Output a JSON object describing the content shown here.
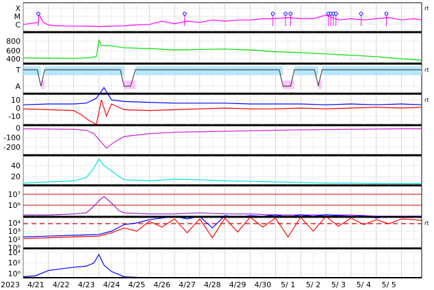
{
  "chart_data": [
    {
      "type": "line",
      "panel": "xray-flares",
      "ylabels": [
        "X",
        "M",
        "C"
      ],
      "right_label": "rt",
      "colors": {
        "line": "#ff00ff",
        "marker": "#0000ff"
      },
      "series": [
        {
          "x": [
            0,
            0.6,
            0.6,
            0.8,
            1,
            1.2,
            1.5,
            2,
            2.5,
            3,
            3.5,
            4,
            4.5,
            5,
            5.5,
            6,
            6.5,
            7,
            7.5,
            8,
            8.5,
            9,
            9.5,
            10,
            10.5,
            11,
            11.5,
            12,
            12.5,
            13,
            13.5,
            14,
            14.5,
            15,
            15.5,
            15.8
          ],
          "values": [
            0.12,
            0.2,
            0.55,
            0.2,
            0.1,
            0.07,
            0.06,
            0.05,
            0.05,
            0.04,
            0.05,
            0.06,
            0.1,
            0.12,
            0.25,
            0.15,
            0.25,
            0.2,
            0.3,
            0.25,
            0.3,
            0.3,
            0.35,
            0.35,
            0.4,
            0.35,
            0.35,
            0.5,
            0.3,
            0.35,
            0.3,
            0.35,
            0.4,
            0.3,
            0.35,
            0.3
          ]
        }
      ],
      "flare_markers": [
        0.6,
        6.4,
        9.9,
        10.4,
        10.6,
        12.1,
        12.2,
        12.3,
        12.4,
        13.4,
        14.4
      ]
    },
    {
      "type": "line",
      "panel": "solar-wind-speed",
      "yticks": [
        "800",
        "600",
        "400"
      ],
      "colors": {
        "line": "#00e000"
      },
      "series": [
        {
          "x": [
            0,
            1,
            2,
            2.5,
            2.9,
            3.0,
            3.1,
            3.5,
            4,
            5,
            6,
            7,
            8,
            9,
            10,
            11,
            12,
            13,
            14,
            15,
            15.8
          ],
          "values": [
            420,
            415,
            410,
            420,
            450,
            820,
            700,
            690,
            650,
            630,
            600,
            610,
            620,
            600,
            560,
            540,
            510,
            480,
            450,
            400,
            370
          ]
        }
      ]
    },
    {
      "type": "line",
      "panel": "imf-sector",
      "ylabels": [
        "T",
        "A"
      ],
      "right_label": "rt",
      "colors": {
        "toward": "#a8e4ff",
        "away": "#ffb8ff",
        "trace": "#4a4a4a"
      },
      "series": [
        {
          "x": [
            0,
            0.55,
            0.7,
            0.85,
            3.85,
            4.0,
            4.25,
            4.45,
            10.15,
            10.3,
            10.6,
            10.75,
            11.55,
            11.7,
            11.85,
            15.8
          ],
          "values": [
            1,
            1,
            0,
            1,
            1,
            0,
            0,
            1,
            1,
            0,
            0,
            1,
            1,
            0,
            1,
            1
          ]
        }
      ]
    },
    {
      "type": "line",
      "panel": "imf-bz",
      "yticks": [
        "10",
        "0",
        "-10"
      ],
      "right_label": "rt",
      "colors": {
        "bt": "#0000ff",
        "bz": "#ff0000"
      },
      "series": [
        {
          "x": [
            0,
            1,
            2,
            2.5,
            2.9,
            3.2,
            3.5,
            4,
            5,
            6,
            7,
            8,
            9,
            10,
            11,
            12,
            13,
            14,
            15,
            15.8
          ],
          "values": [
            4,
            5,
            5,
            6,
            12,
            25,
            10,
            8,
            7,
            6,
            6,
            6,
            5,
            5,
            5,
            4,
            5,
            4,
            5,
            4
          ]
        },
        {
          "x": [
            0,
            1,
            2,
            2.3,
            2.6,
            2.9,
            3.1,
            3.3,
            3.5,
            4,
            5,
            6,
            7,
            8,
            9,
            10,
            11,
            12,
            13,
            14,
            15,
            15.8
          ],
          "values": [
            -1,
            -2,
            -3,
            -8,
            -15,
            -20,
            10,
            -10,
            5,
            -2,
            -3,
            -2,
            -1,
            0,
            -1,
            -1,
            0,
            -1,
            0,
            1,
            0,
            1
          ]
        }
      ]
    },
    {
      "type": "line",
      "panel": "dst-index",
      "yticks": [
        "0",
        "-100",
        "-200"
      ],
      "colors": {
        "line": "#d020d0"
      },
      "series": [
        {
          "x": [
            0,
            1,
            2,
            2.5,
            2.8,
            3.0,
            3.1,
            3.3,
            3.6,
            4,
            5,
            6,
            7,
            8,
            9,
            10,
            11,
            12,
            13,
            14,
            15,
            15.8
          ],
          "values": [
            -10,
            -12,
            -15,
            -25,
            -60,
            -120,
            -150,
            -213,
            -150,
            -90,
            -60,
            -45,
            -40,
            -35,
            -30,
            -25,
            -20,
            -18,
            -15,
            -12,
            -10,
            -10
          ]
        }
      ]
    },
    {
      "type": "line",
      "panel": "proton-density",
      "yticks": [
        "40",
        "20"
      ],
      "colors": {
        "line": "#00e0e0"
      },
      "series": [
        {
          "x": [
            0,
            1,
            2,
            2.5,
            2.8,
            3.0,
            3.2,
            3.5,
            3.8,
            4,
            5,
            6,
            7,
            8,
            9,
            10,
            11,
            12,
            13,
            14,
            15,
            15.8
          ],
          "values": [
            8,
            10,
            12,
            18,
            35,
            52,
            40,
            30,
            20,
            14,
            12,
            15,
            14,
            12,
            11,
            10,
            9,
            8,
            8,
            7,
            7,
            7
          ]
        }
      ]
    },
    {
      "type": "line",
      "panel": "proton-temperature",
      "yticks": [
        "10⁷",
        "10⁶"
      ],
      "colors": {
        "line": "#9020c0",
        "reference": "#cc0000"
      },
      "series": [
        {
          "x": [
            0,
            1,
            2,
            2.5,
            2.8,
            3.0,
            3.2,
            3.5,
            3.8,
            4,
            5,
            6,
            7,
            8,
            9,
            10,
            11,
            12,
            13,
            14,
            15,
            15.8
          ],
          "values": [
            5.1,
            5.1,
            5.2,
            5.3,
            5.9,
            6.4,
            6.8,
            6.2,
            5.5,
            5.3,
            5.2,
            5.2,
            5.3,
            5.2,
            5.2,
            5.1,
            5.1,
            5.1,
            5.1,
            5.0,
            5.0,
            5.0
          ]
        }
      ]
    },
    {
      "type": "line",
      "panel": "electron-flux",
      "yticks": [
        "10⁴",
        "10³",
        "10²",
        "10⁰"
      ],
      "right_label": "rt",
      "colors": {
        "line1": "#0000ff",
        "line2": "#ff0000",
        "threshold": "#cc0000"
      },
      "series": [
        {
          "x": [
            0,
            1,
            2,
            3,
            3.5,
            4,
            4.5,
            5,
            5.5,
            6,
            6.5,
            7,
            7.5,
            8,
            8.5,
            9,
            9.5,
            10,
            10.5,
            11,
            11.5,
            12,
            12.5,
            13,
            13.5,
            14,
            14.5,
            15,
            15.5,
            15.8
          ],
          "values": [
            1.3,
            1.4,
            1.5,
            1.6,
            2.0,
            2.8,
            3.0,
            3.4,
            3.6,
            3.8,
            3.5,
            3.8,
            2.4,
            3.9,
            3.7,
            3.9,
            3.8,
            4.0,
            3.7,
            4.0,
            3.8,
            4.0,
            3.9,
            3.8,
            3.9,
            3.6,
            3.8,
            3.7,
            3.8,
            3.8
          ]
        },
        {
          "x": [
            0,
            1,
            2,
            3,
            3.5,
            4,
            4.5,
            5,
            5.5,
            6,
            6.5,
            7,
            7.5,
            8,
            8.5,
            9,
            9.5,
            10,
            10.5,
            11,
            11.5,
            12,
            12.5,
            13,
            13.5,
            14,
            14.5,
            15,
            15.5,
            15.8
          ],
          "values": [
            1.1,
            1.2,
            1.3,
            1.4,
            1.8,
            2.4,
            2.0,
            3.2,
            2.5,
            3.5,
            1.8,
            3.5,
            1.2,
            3.6,
            1.9,
            3.7,
            2.5,
            3.6,
            1.3,
            3.7,
            2.0,
            3.8,
            2.6,
            3.6,
            2.8,
            3.4,
            2.9,
            3.5,
            3.4,
            3.3
          ]
        }
      ]
    },
    {
      "type": "line",
      "panel": "proton-flux",
      "yticks": [
        "10⁴",
        "10²",
        "10⁰"
      ],
      "colors": {
        "line": "#0000ff"
      },
      "series": [
        {
          "x": [
            0,
            0.5,
            1,
            2,
            2.5,
            2.8,
            3.0,
            3.2,
            3.5,
            4,
            5,
            6,
            7,
            8,
            9,
            10,
            11,
            12,
            13,
            14,
            15,
            15.8
          ],
          "values": [
            -0.3,
            -0.2,
            0.3,
            0.6,
            0.7,
            1.0,
            1.8,
            0.8,
            0.2,
            -0.3,
            -0.4,
            -0.4,
            -0.4,
            -0.4,
            -0.4,
            -0.4,
            -0.4,
            -0.4,
            -0.4,
            -0.4,
            -0.4,
            -0.4
          ]
        }
      ]
    }
  ],
  "x_axis": {
    "year": "2023",
    "tick_labels": [
      "4/21",
      "4/22",
      "4/23",
      "4/24",
      "4/25",
      "4/26",
      "4/27",
      "4/28",
      "4/29",
      "4/30",
      "5/ 1",
      "5/ 2",
      "5/ 3",
      "5/ 4",
      "5/ 5"
    ]
  }
}
